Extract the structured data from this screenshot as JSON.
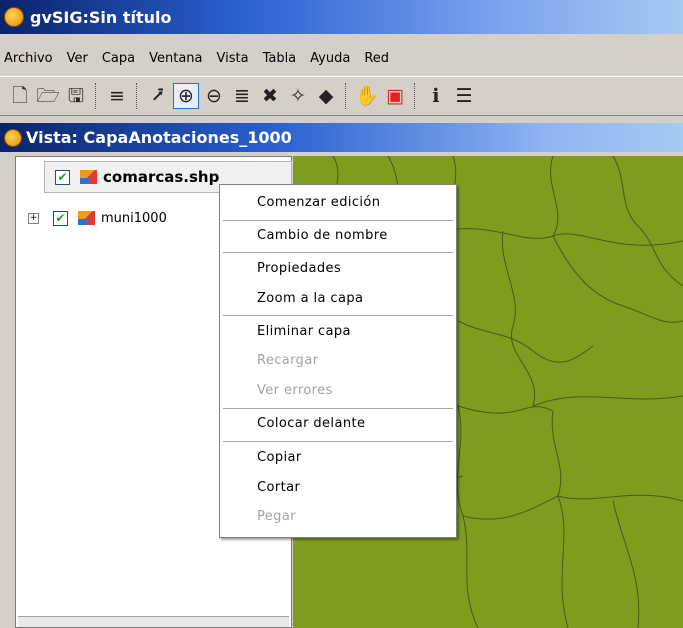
{
  "app": {
    "title": "gvSIG:Sin título"
  },
  "menubar": {
    "items": [
      "Archivo",
      "Ver",
      "Capa",
      "Ventana",
      "Vista",
      "Tabla",
      "Ayuda",
      "Red"
    ]
  },
  "toolbar": {
    "buttons": [
      "new-file-icon",
      "open-folder-icon",
      "save-disk-icon",
      "layers-icon",
      "zoom-select-icon",
      "zoom-in-icon",
      "zoom-out-icon",
      "zoom-layers-icon",
      "zoom-full-icon",
      "zoom-extent-icon",
      "pan-eye-icon",
      "pan-hand-icon",
      "layer-overlap-icon",
      "info-icon",
      "measure-icon"
    ]
  },
  "view": {
    "title": "Vista: CapaAnotaciones_1000"
  },
  "toc": {
    "layers": [
      {
        "name": "comarcas.shp",
        "checked": true,
        "selected": true
      },
      {
        "name": "muni1000",
        "checked": true,
        "selected": false,
        "expand": "+"
      }
    ]
  },
  "context_menu": {
    "items": [
      {
        "label": "Comenzar edición",
        "enabled": true
      },
      {
        "label": "Cambio de nombre",
        "enabled": true
      },
      {
        "label": "Propiedades",
        "enabled": true
      },
      {
        "label": "Zoom a la capa",
        "enabled": true
      },
      {
        "label": "Eliminar capa",
        "enabled": true
      },
      {
        "label": "Recargar",
        "enabled": false
      },
      {
        "label": "Ver errores",
        "enabled": false
      },
      {
        "label": "Colocar delante",
        "enabled": true
      },
      {
        "label": "Copiar",
        "enabled": true
      },
      {
        "label": "Cortar",
        "enabled": true
      },
      {
        "label": "Pegar",
        "enabled": false
      }
    ]
  },
  "colors": {
    "titlebar": "#0a246a",
    "map_fill": "#7f9c1e",
    "map_border": "#4a5a12",
    "check": "#21a121",
    "disabled_text": "#a3a3a3"
  }
}
